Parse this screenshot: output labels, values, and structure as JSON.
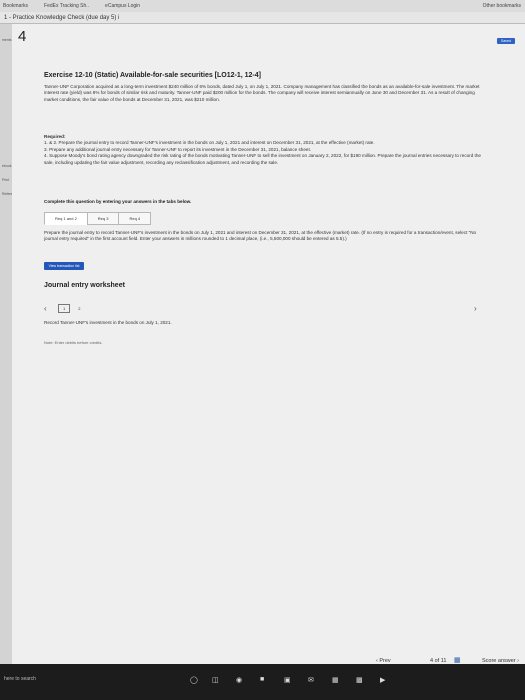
{
  "browser": {
    "bookmarks": [
      "Bookmarks",
      "FedEx Tracking Sh..",
      "eCampus Login"
    ],
    "bookmarks_right": "Other bookmarks",
    "tab_title": "1 - Practice Knowledge Check (due day 5) i"
  },
  "sidebar": {
    "items": [
      "ments",
      "ebook",
      "Print",
      "References"
    ]
  },
  "question": {
    "number": "4",
    "send_label": "Saved"
  },
  "exercise": {
    "title": "Exercise 12-10 (Static) Available-for-sale securities [LO12-1, 12-4]",
    "problem": "Tanner-UNF Corporation acquired as a long-term investment $240 million of 6% bonds, dated July 1, on July 1, 2021. Company management has classified the bonds as an available-for-sale investment. The market interest rate (yield) was 8% for bonds of similar risk and maturity. Tanner-UNF paid $200 million for the bonds. The company will receive interest semiannually on June 30 and December 31. As a result of changing market conditions, the fair value of the bonds at December 31, 2021, was $210 million.",
    "required_heading": "Required:",
    "required_items": [
      "1. & 2. Prepare the journal entry to record Tanner-UNF's investment in the bonds on July 1, 2021 and interest on December 31, 2021, at the effective (market) rate.",
      "3. Prepare any additional journal entry necessary for Tanner-UNF to report its investment in the December 31, 2021, balance sheet.",
      "4. Suppose Moody's bond rating agency downgraded the risk rating of the bonds motivating Tanner-UNF to sell the investment on January 2, 2022, for $190 million. Prepare the journal entries necessary to record the sale, including updating the fair value adjustment, recording any reclassification adjustment, and recording the sale."
    ]
  },
  "instruction": "Complete this question by entering your answers in the tabs below.",
  "tabs": [
    {
      "label": "Req 1 and 2",
      "active": true
    },
    {
      "label": "Req 3",
      "active": false
    },
    {
      "label": "Req 4",
      "active": false
    }
  ],
  "task_text": "Prepare the journal entry to record Tanner-UNF's investment in the bonds on July 1, 2021 and interest on December 31, 2021, at the effective (market) rate. (If no entry is required for a transaction/event, select \"No journal entry required\" in the first account field. Enter your answers in millions rounded to 1 decimal place, (i.e., 5,500,000 should be entered as 5.5).)",
  "view_button_label": "View transaction list",
  "worksheet": {
    "title": "Journal entry worksheet",
    "pages": [
      "1",
      "2"
    ],
    "current_page": "1",
    "entry_text": "Record Tanner-UNF's investment in the bonds on July 1, 2021.",
    "note": "Note: Enter debits before credits."
  },
  "navigation": {
    "prev_label": "Prev",
    "position": "4 of 11",
    "score_label": "Score answer"
  },
  "taskbar": {
    "search_label": "here to search"
  }
}
